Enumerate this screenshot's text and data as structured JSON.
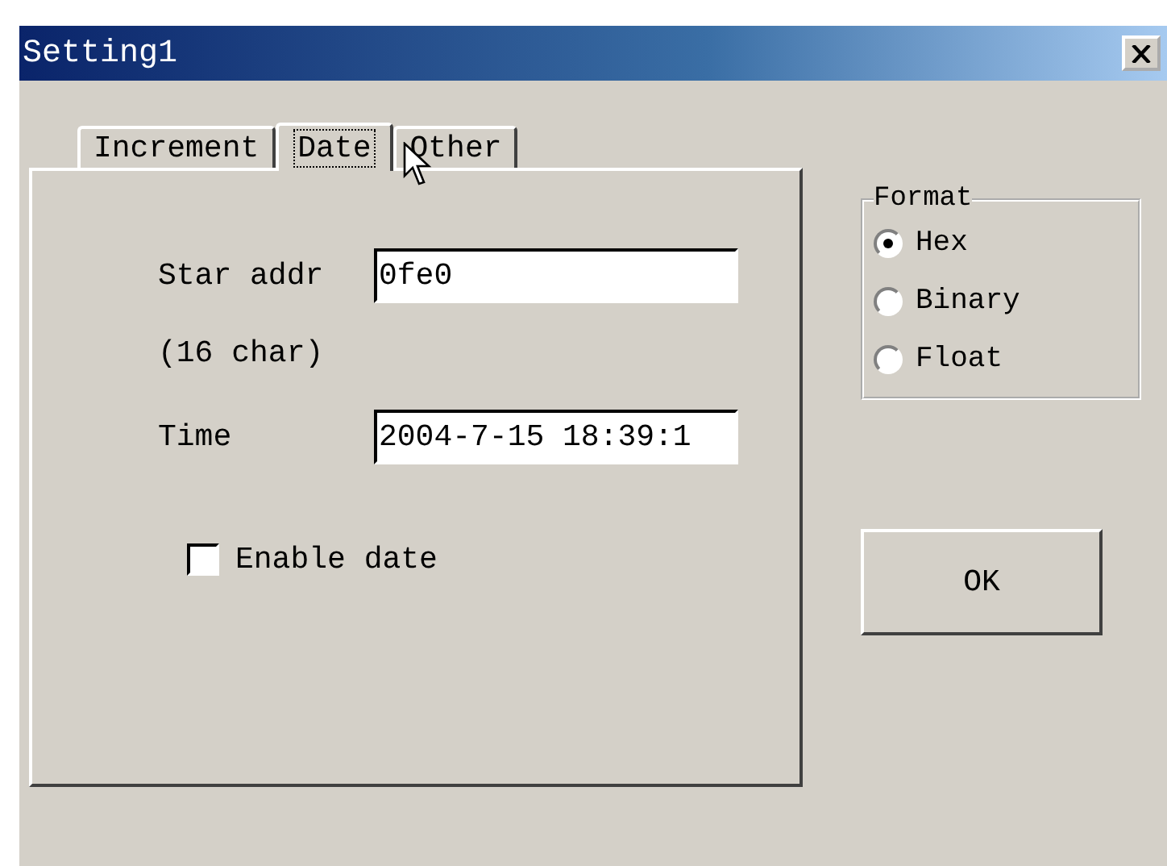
{
  "window": {
    "title": "Setting1"
  },
  "tabs": [
    {
      "label": "Increment",
      "selected": false
    },
    {
      "label": "Date",
      "selected": true
    },
    {
      "label": "Other",
      "selected": false
    }
  ],
  "date_tab": {
    "start_address": {
      "label": "Star addr",
      "note": "(16 char)",
      "value": "0fe0"
    },
    "time": {
      "label": "Time",
      "value": "2004-7-15 18:39:1"
    },
    "enable_date": {
      "label": "Enable date",
      "checked": false
    }
  },
  "format": {
    "title": "Format",
    "options": [
      {
        "label": "Hex",
        "selected": true
      },
      {
        "label": "Binary",
        "selected": false
      },
      {
        "label": "Float",
        "selected": false
      }
    ]
  },
  "buttons": [
    {
      "label": "OK"
    }
  ]
}
